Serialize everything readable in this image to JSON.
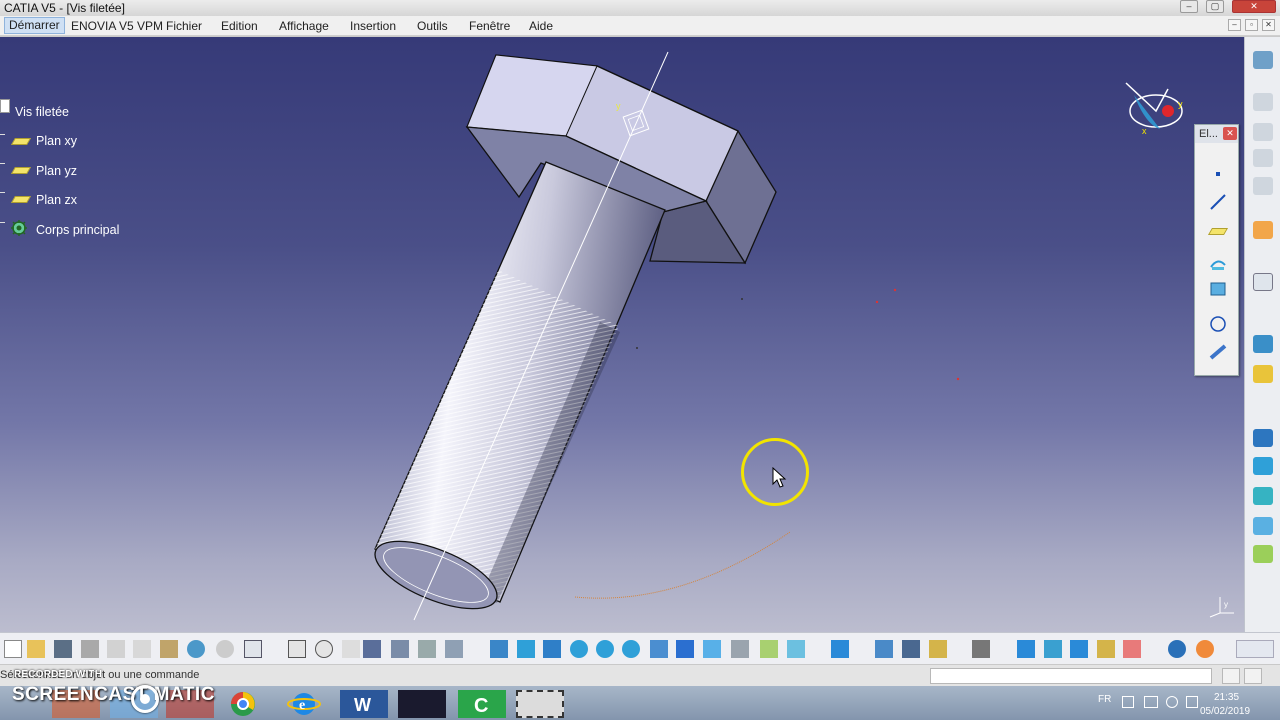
{
  "window": {
    "title": "CATIA V5 - [Vis filetée]"
  },
  "menu": {
    "items": [
      "Démarrer",
      "ENOVIA V5 VPM",
      "Fichier",
      "Edition",
      "Affichage",
      "Insertion",
      "Outils",
      "Fenêtre",
      "Aide"
    ]
  },
  "tree": {
    "root": "Vis filetée",
    "items": [
      {
        "label": "Plan xy",
        "icon": "plane-icon"
      },
      {
        "label": "Plan yz",
        "icon": "plane-icon"
      },
      {
        "label": "Plan zx",
        "icon": "plane-icon"
      },
      {
        "label": "Corps principal",
        "icon": "part-body-icon"
      }
    ]
  },
  "floating_toolbar": {
    "title": "El..."
  },
  "status": {
    "message": "Sélectionnez un objet ou une commande"
  },
  "taskbar": {
    "lang": "FR",
    "time": "21:35",
    "date": "05/02/2019"
  },
  "watermark": {
    "line1": "RECORDED WITH",
    "line2": "SCREENCAST   MATIC"
  },
  "colors": {
    "viewport_top": "#363a78",
    "viewport_bottom": "#bcbdcf",
    "accent": "#f2e400"
  }
}
